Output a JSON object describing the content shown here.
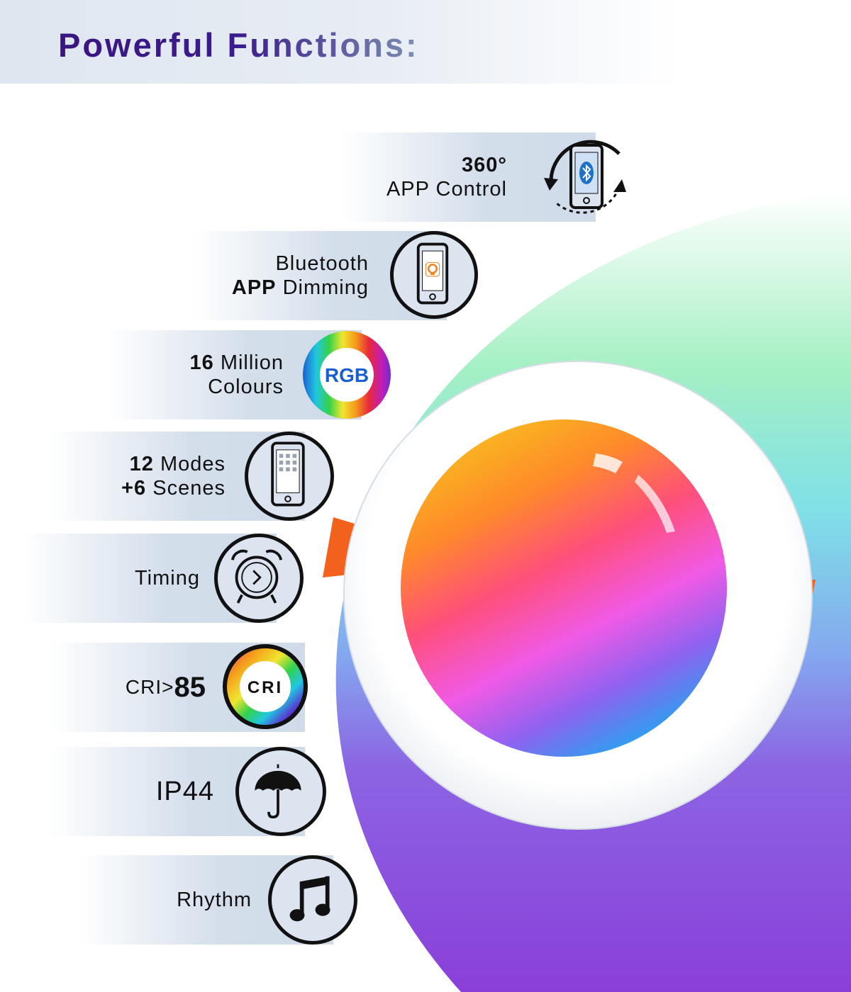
{
  "header": {
    "title": "Powerful Functions:"
  },
  "features": [
    {
      "line1_bold": "360°",
      "line2_prefix_bold": "",
      "line2": "APP Control",
      "icon": "bluetooth-phone-rotate-icon"
    },
    {
      "line1": "Bluetooth",
      "line2_bold": "APP",
      "line2": "Dimming",
      "icon": "app-phone-icon"
    },
    {
      "line1_bold": "16",
      "line1": "Million",
      "line2": "Colours",
      "icon": "rgb-ring-icon",
      "icon_text": "RGB"
    },
    {
      "line1_bold": "12",
      "line1": "Modes",
      "line2_bold": "+6",
      "line2": "Scenes",
      "icon": "modes-phone-icon"
    },
    {
      "line1": "Timing",
      "icon": "alarm-clock-icon"
    },
    {
      "prefix": "CRI>",
      "value": "85",
      "icon": "cri-ring-icon",
      "icon_text": "CRI"
    },
    {
      "line1": "IP44",
      "icon": "umbrella-icon"
    },
    {
      "line1": "Rhythm",
      "icon": "music-note-icon"
    }
  ],
  "colors": {
    "title": "#3b1c8c",
    "outline": "#111111",
    "band": "#cfdbe9",
    "tab_orange": "#f2621d"
  }
}
